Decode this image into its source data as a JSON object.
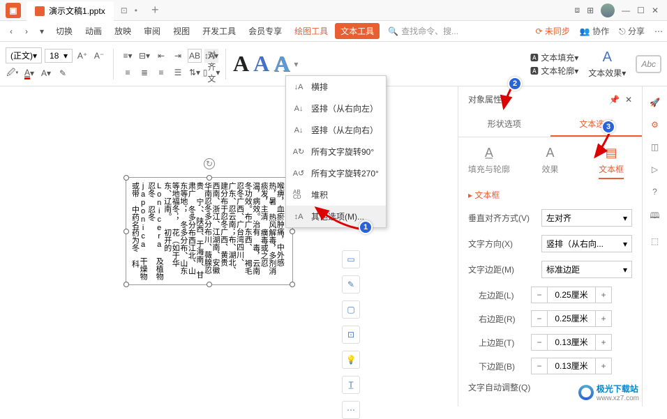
{
  "titlebar": {
    "doc_name": "演示文稿1.pptx",
    "new_tab": "+"
  },
  "menu": {
    "items_left": [
      "切换",
      "动画",
      "放映",
      "审阅",
      "视图",
      "开发工具",
      "会员专享"
    ],
    "items_orange": [
      "绘图工具",
      "文本工具"
    ],
    "search_placeholder": "查找命令、搜...",
    "right": {
      "unsync": "未同步",
      "collab": "协作",
      "share": "分享"
    }
  },
  "toolbar": {
    "font": "(正文)",
    "size": "18",
    "align_text": "对齐文本",
    "fill": "文本填充",
    "outline": "文本轮廓",
    "effect": "文本效果",
    "abc": "Abc",
    "wa": "A"
  },
  "dropdown": {
    "items": [
      {
        "icon": "↓A",
        "label": "横排"
      },
      {
        "icon": "A↓",
        "label": "竖排（从右向左）"
      },
      {
        "icon": "A↓",
        "label": "竖排（从左向右）"
      },
      {
        "icon": "A↻",
        "label": "所有文字旋转90°"
      },
      {
        "icon": "A↺",
        "label": "所有文字旋转270°"
      },
      {
        "icon": "AB\nCD",
        "label": "堆积"
      },
      {
        "icon": "↕A",
        "label": "其他选项(M)..."
      }
    ]
  },
  "slide": {
    "text": "喉痹，血瘀肿痛，中外感热，暑\n热风解毒，多剂消痰发，主清\n癀毒或之忍温，病效。治有\n毒，云南冬功效。布广东西、\n褐毛忍冬广西、广台湾四川、\n广东、忍云南；布、湖北、\n建分布于忍冬广西、黄贵\n西南、浙江、江湖南、安徽\n华南忍冬多分布川、薇腺忍贵\n宁、、陕西、于海南、甘肃广\n冬多分布西江北、山东等地；\n冬多分布、山东等地福冬；\n花（如于华东、辽南。\n初开的 Lonicera 及植物忍冬\n忍冬 japonica 干燥物或带\n中药名药为冬\n科"
  },
  "panel": {
    "title": "对象属性",
    "tabs": {
      "shape": "形状选项",
      "text": "文本选项"
    },
    "subtabs": {
      "fill": "填充与轮廓",
      "effect": "效果",
      "textbox": "文本框"
    },
    "section": "文本框",
    "valign_label": "垂直对齐方式(V)",
    "valign_value": "左对齐",
    "dir_label": "文字方向(X)",
    "dir_value": "竖排（从右向...",
    "margin_label": "文字边距(M)",
    "margin_value": "标准边距",
    "left_label": "左边距(L)",
    "right_label": "右边距(R)",
    "top_label": "上边距(T)",
    "bottom_label": "下边距(B)",
    "lr_value": "0.25厘米",
    "tb_value": "0.13厘米",
    "autofit": "文字自动调整(Q)"
  },
  "watermark": "极光下载站",
  "watermark_url": "www.xz7.com"
}
